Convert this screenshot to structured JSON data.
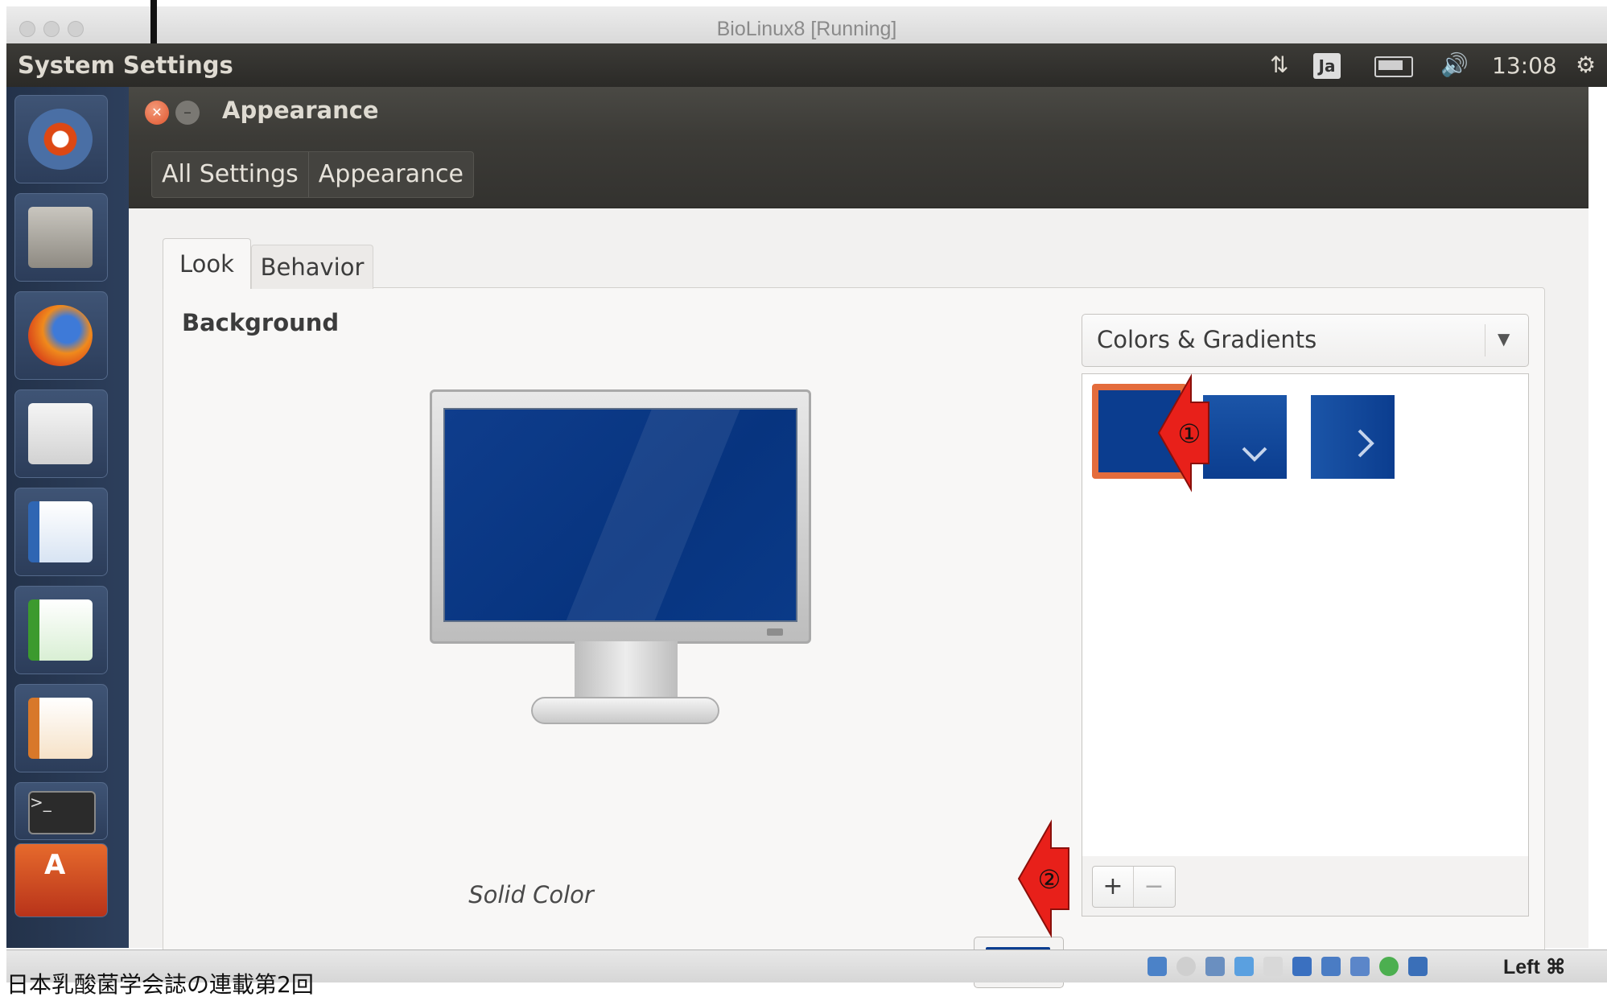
{
  "host_window": {
    "title": "BioLinux8 [Running]"
  },
  "top_panel": {
    "title": "System Settings",
    "input_method": "Ja",
    "time": "13:08"
  },
  "window": {
    "title": "Appearance",
    "breadcrumb": [
      "All Settings",
      "Appearance"
    ]
  },
  "tabs": [
    {
      "label": "Look",
      "selected": true
    },
    {
      "label": "Behavior",
      "selected": false
    }
  ],
  "background": {
    "heading": "Background",
    "preview_label": "Solid Color",
    "dropdown_value": "Colors & Gradients",
    "gallery": [
      {
        "name": "solid",
        "color": "#0b3d8f",
        "selected": true
      },
      {
        "name": "vertical-gradient",
        "color": "#0b3d8f"
      },
      {
        "name": "horizontal-gradient",
        "color": "#0b3d8f"
      }
    ],
    "add_label": "+",
    "remove_label": "−",
    "selected_color": "#0b3d8f"
  },
  "annotations": [
    {
      "label": "①",
      "color": "#e8201a"
    },
    {
      "label": "②",
      "color": "#e8201a"
    }
  ],
  "status_bar": {
    "host_key": "Left ⌘"
  },
  "caption": "日本乳酸菌学会誌の連載第2回"
}
